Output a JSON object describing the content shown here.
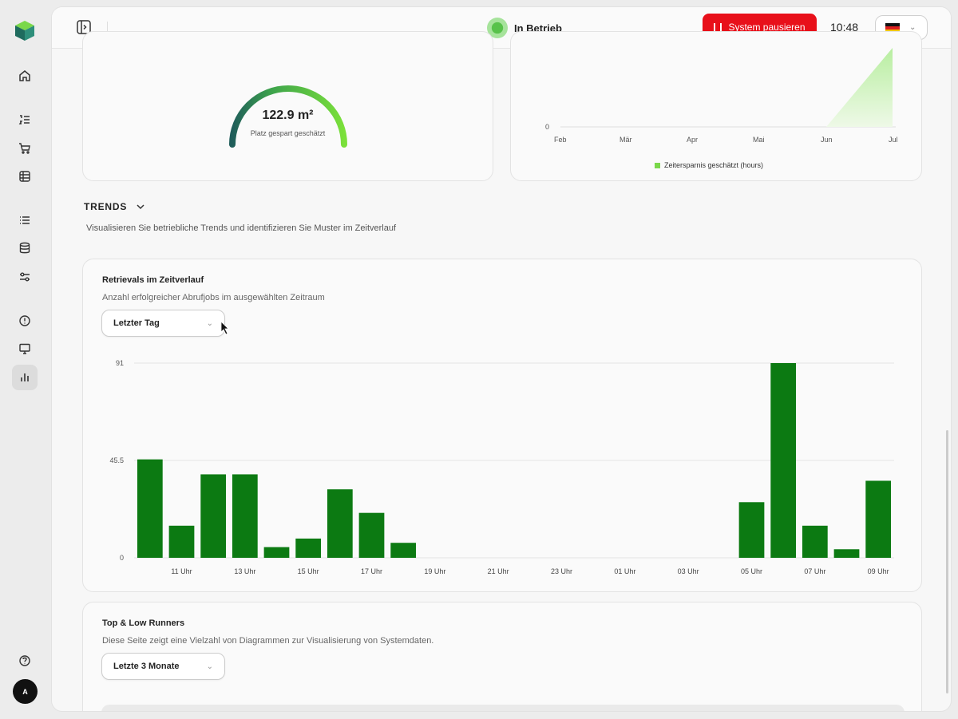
{
  "header": {
    "status_label": "In Betrieb",
    "pause_button_label": "System pausieren",
    "time": "10:48",
    "language": "de",
    "colors": {
      "pause": "#e8101a",
      "status": "#58c24a"
    }
  },
  "sidebar": {
    "items": [
      {
        "name": "home",
        "icon": "home-icon"
      },
      {
        "name": "orders",
        "icon": "numbered-list-icon"
      },
      {
        "name": "cart",
        "icon": "cart-icon"
      },
      {
        "name": "storage",
        "icon": "storage-icon"
      },
      {
        "name": "list",
        "icon": "list-icon"
      },
      {
        "name": "database",
        "icon": "database-icon"
      },
      {
        "name": "settings",
        "icon": "sliders-icon"
      },
      {
        "name": "alerts",
        "icon": "alert-icon"
      },
      {
        "name": "monitor",
        "icon": "monitor-icon"
      },
      {
        "name": "analytics",
        "icon": "bar-chart-icon",
        "active": true
      }
    ],
    "help_icon": "help-icon",
    "avatar_initial": "A"
  },
  "gauge_card": {
    "value": "122.9 m²",
    "label": "Platz gespart geschätzt",
    "fill_fraction": 1.0
  },
  "savings_chart": {
    "y_tick": "0",
    "x_ticks": [
      "Feb",
      "Mär",
      "Apr",
      "Mai",
      "Jun",
      "Jul"
    ],
    "legend": "Zeitersparnis geschätzt (hours)"
  },
  "trends": {
    "title": "TRENDS",
    "description": "Visualisieren Sie betriebliche Trends und identifizieren Sie Muster im Zeitverlauf"
  },
  "retrievals_card": {
    "title": "Retrievals im Zeitverlauf",
    "subtitle": "Anzahl erfolgreicher Abrufjobs im ausgewählten Zeitraum",
    "range_select": "Letzter Tag"
  },
  "chart_data": {
    "type": "bar",
    "color": "#0c7a12",
    "ylim": [
      0,
      91
    ],
    "yticks": [
      "0",
      "45.5",
      "91"
    ],
    "categories": [
      "10 Uhr",
      "11 Uhr",
      "12 Uhr",
      "13 Uhr",
      "14 Uhr",
      "15 Uhr",
      "16 Uhr",
      "17 Uhr",
      "18 Uhr",
      "19 Uhr",
      "20 Uhr",
      "21 Uhr",
      "22 Uhr",
      "23 Uhr",
      "00 Uhr",
      "01 Uhr",
      "02 Uhr",
      "03 Uhr",
      "04 Uhr",
      "05 Uhr",
      "06 Uhr",
      "07 Uhr",
      "08 Uhr",
      "09 Uhr"
    ],
    "visible_tick_labels": [
      "11 Uhr",
      "13 Uhr",
      "15 Uhr",
      "17 Uhr",
      "19 Uhr",
      "21 Uhr",
      "23 Uhr",
      "01 Uhr",
      "03 Uhr",
      "05 Uhr",
      "07 Uhr",
      "09 Uhr"
    ],
    "values": [
      46,
      15,
      39,
      39,
      5,
      9,
      32,
      21,
      7,
      0,
      0,
      0,
      0,
      0,
      0,
      0,
      0,
      0,
      0,
      26,
      91,
      15,
      4,
      36
    ]
  },
  "runners_card": {
    "title": "Top & Low Runners",
    "subtitle": "Diese Seite zeigt eine Vielzahl von Diagrammen zur Visualisierung von Systemdaten.",
    "range_select": "Letzte 3 Monate"
  }
}
